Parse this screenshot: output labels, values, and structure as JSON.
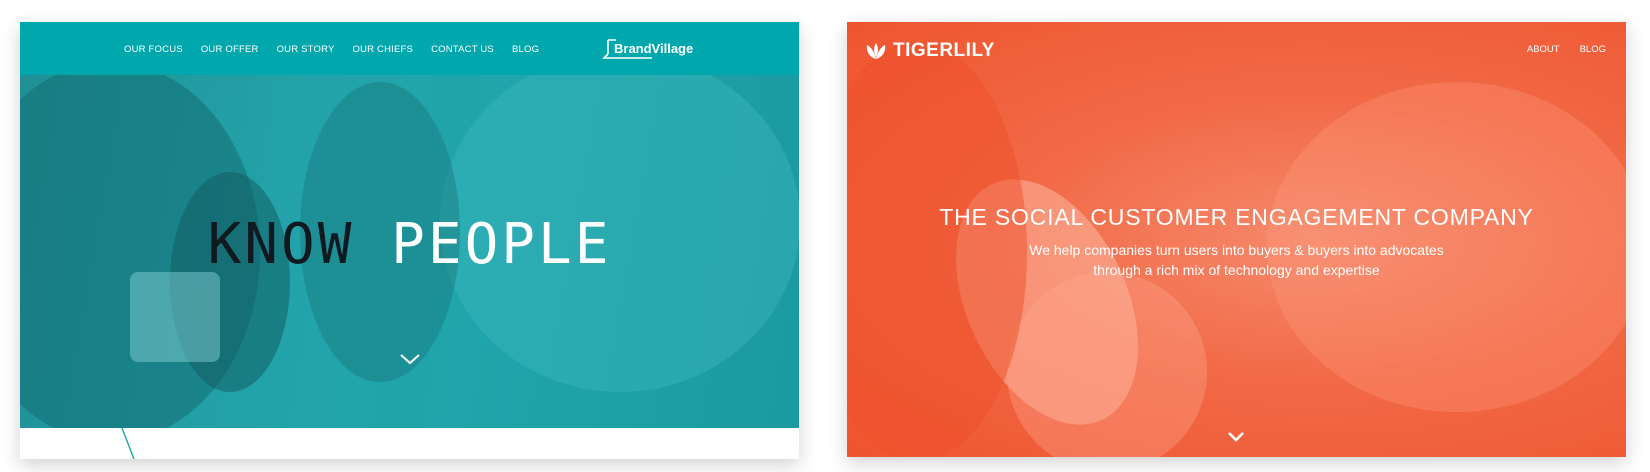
{
  "brandvillage": {
    "nav": [
      "OUR FOCUS",
      "OUR OFFER",
      "OUR STORY",
      "OUR CHIEFS",
      "CONTACT US",
      "BLOG"
    ],
    "logo_text": "BrandVillage",
    "headline_dark": "KNOW",
    "headline_light": "PEOPLE",
    "colors": {
      "nav": "#00a7ad",
      "hero": "#23a3a9"
    }
  },
  "tigerlily": {
    "logo_text": "TIGERLILY",
    "nav": [
      "ABOUT",
      "BLOG"
    ],
    "title": "THE SOCIAL CUSTOMER ENGAGEMENT COMPANY",
    "subtitle_line1": "We help companies turn users into buyers & buyers into advocates",
    "subtitle_line2": "through a rich mix of technology and expertise",
    "colors": {
      "hero": "#f26a47"
    }
  }
}
